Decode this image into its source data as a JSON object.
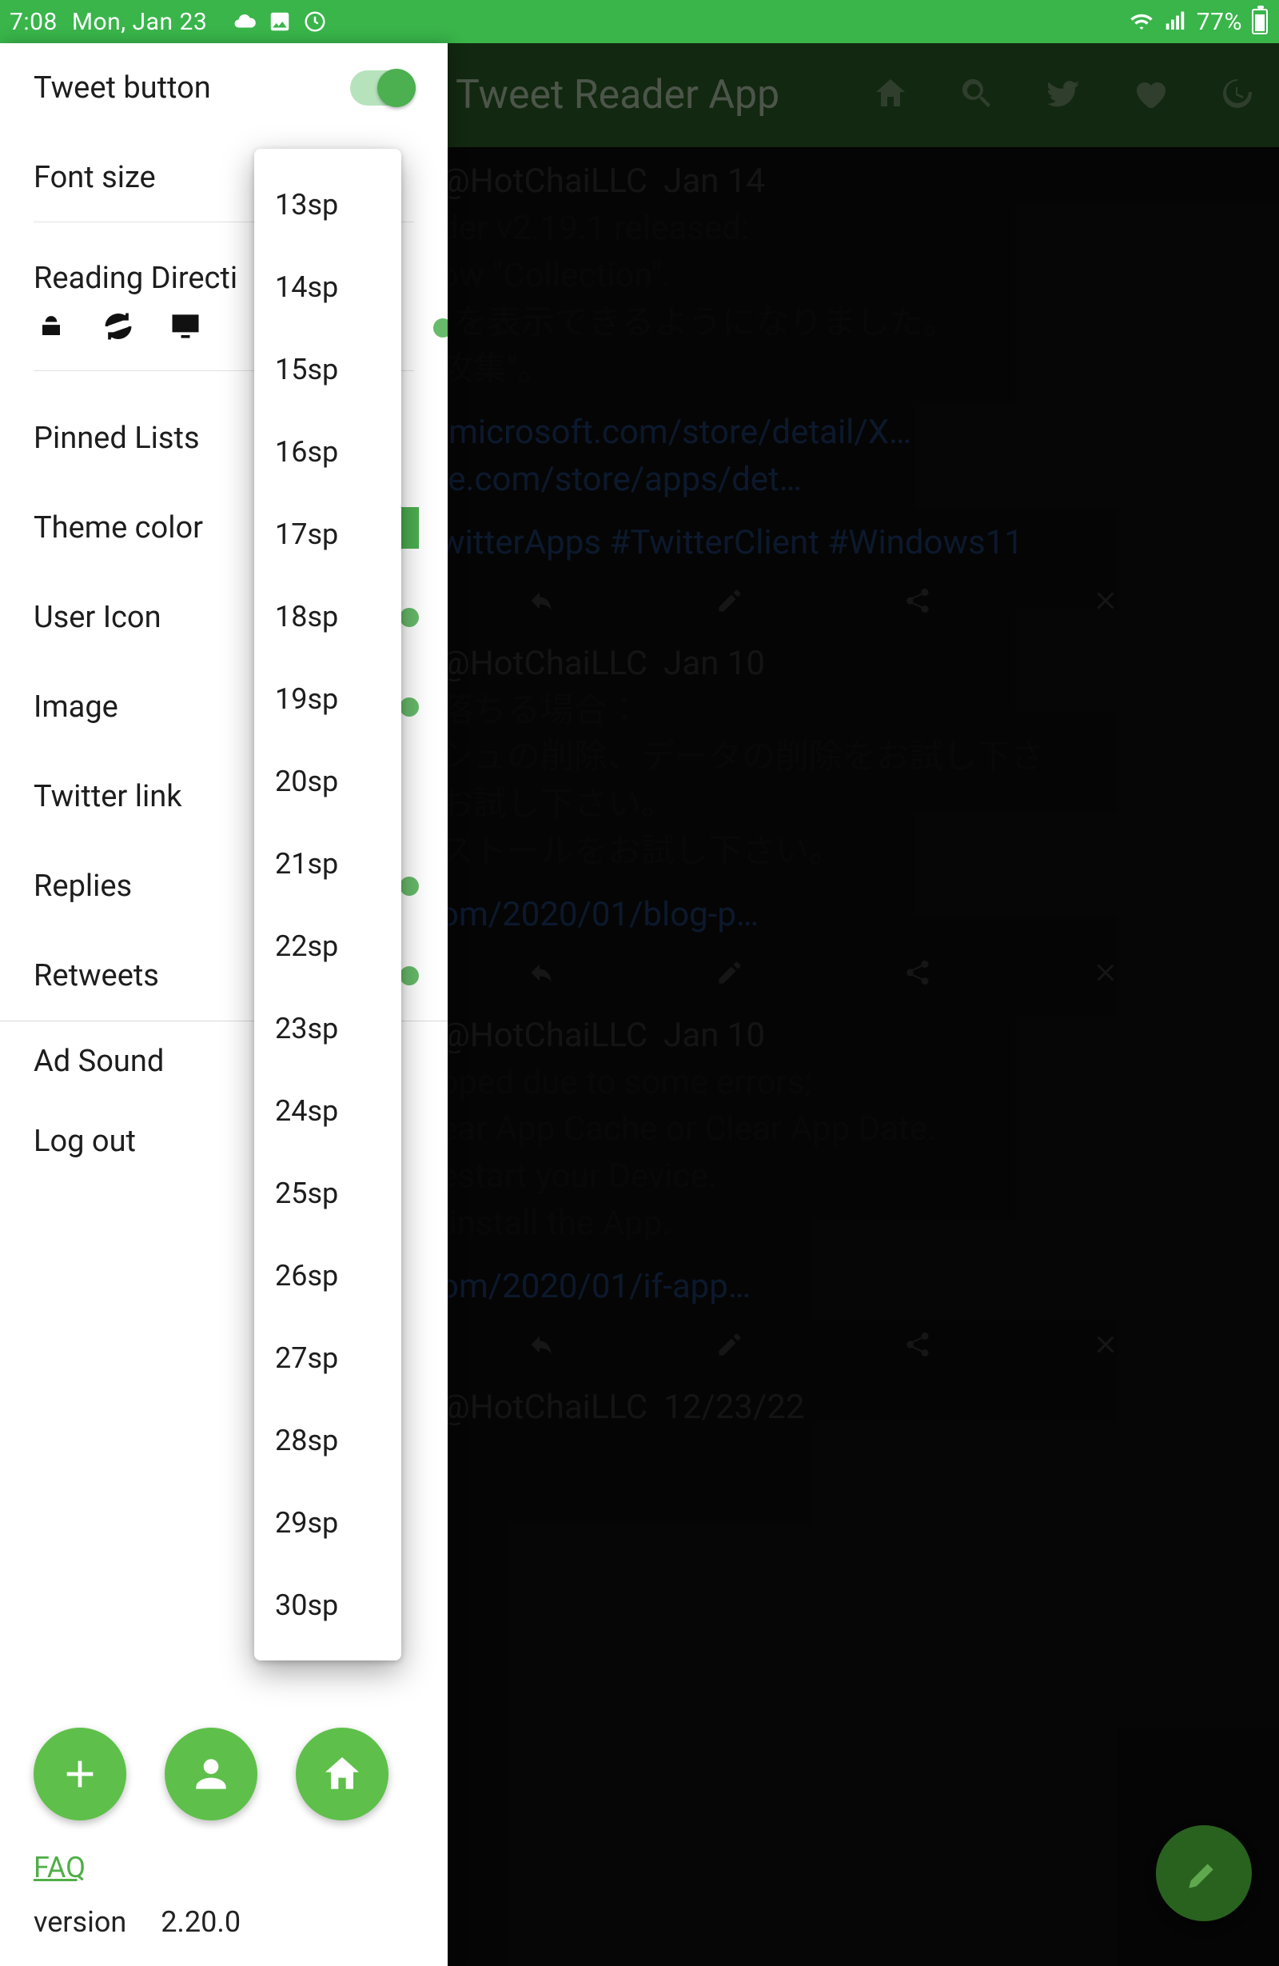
{
  "status": {
    "time": "7:08",
    "date": "Mon, Jan 23",
    "battery_pct": "77%"
  },
  "app": {
    "title": "Tweet Reader App"
  },
  "drawer": {
    "tweet_button": "Tweet button",
    "font_size": "Font size",
    "reading_direction": "Reading Directi",
    "pinned_lists": "Pinned Lists",
    "theme_color": "Theme color",
    "user_icon": "User Icon",
    "image": "Image",
    "twitter_link": "Twitter link",
    "replies": "Replies",
    "retweets": "Retweets",
    "ad_sound": "Ad Sound",
    "log_out": "Log out",
    "faq": "FAQ",
    "version_label": "version",
    "version": "2.20.0"
  },
  "font_size_options": [
    "13sp",
    "14sp",
    "15sp",
    "16sp",
    "17sp",
    "18sp",
    "19sp",
    "20sp",
    "21sp",
    "22sp",
    "23sp",
    "24sp",
    "25sp",
    "26sp",
    "27sp",
    "28sp",
    "29sp",
    "30sp"
  ],
  "feed": [
    {
      "handle": "@HotChaiLLC",
      "date": "Jan 14",
      "lines": [
        "der v2.19.1 released:",
        "ow \"Collection\".",
        "' を表示できるようになりました。",
        "攻集\"。"
      ],
      "links": [
        ".microsoft.com/store/detail/X…",
        "le.com/store/apps/det…"
      ],
      "tags": "witterApps #TwitterClient #Windows11"
    },
    {
      "handle": "@HotChaiLLC",
      "date": "Jan 10",
      "lines": [
        "落ちる場合：",
        "シュの削除、データの削除をお試し下さ",
        "",
        "お試し下さい。",
        "ストールをお試し下さい。"
      ],
      "links": [
        "om/2020/01/blog-p…"
      ]
    },
    {
      "handle": "@HotChaiLLC",
      "date": "Jan 10",
      "lines": [
        "pped due to some errors;",
        "ear App Cache or Clear App Date.",
        "estart your Device.",
        "-install the App."
      ],
      "links": [
        "om/2020/01/if-app…"
      ]
    },
    {
      "handle": "@HotChaiLLC",
      "date": "12/23/22",
      "lines": []
    }
  ]
}
